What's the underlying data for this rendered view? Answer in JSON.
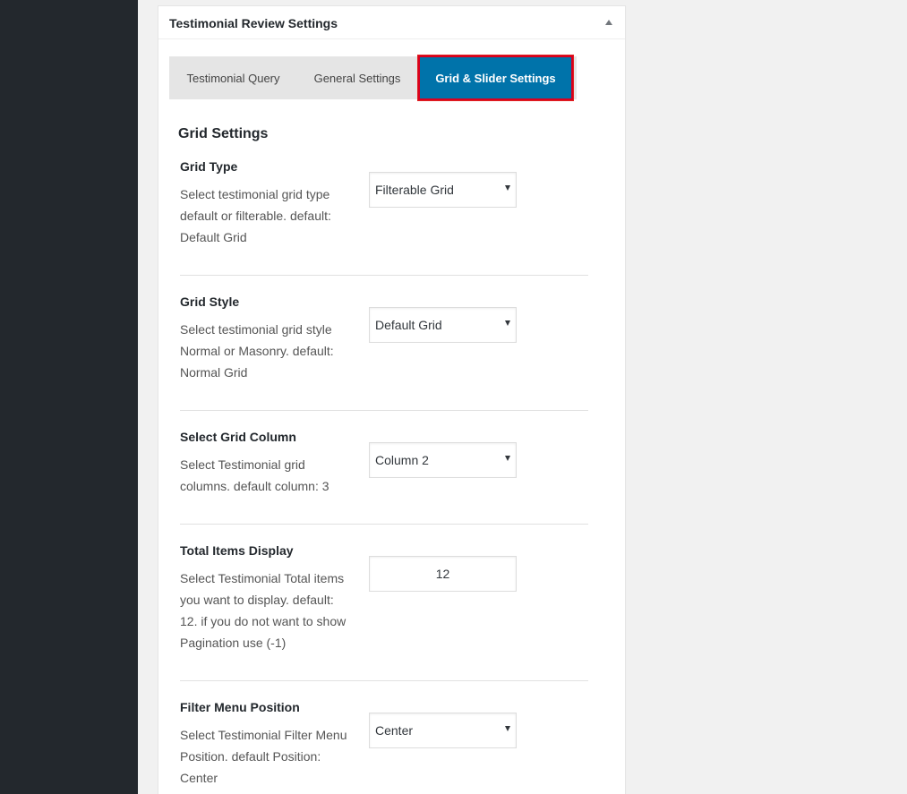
{
  "metabox": {
    "title": "Testimonial Review Settings"
  },
  "tabs": [
    {
      "label": "Testimonial Query"
    },
    {
      "label": "General Settings"
    },
    {
      "label": "Grid & Slider Settings",
      "active": true
    }
  ],
  "section": {
    "title": "Grid Settings"
  },
  "fields": {
    "grid_type": {
      "label": "Grid Type",
      "description": "Select testimonial grid type default or filterable. default: Default Grid",
      "value": "Filterable Grid"
    },
    "grid_style": {
      "label": "Grid Style",
      "description": "Select testimonial grid style Normal or Masonry. default: Normal Grid",
      "value": "Default Grid"
    },
    "grid_column": {
      "label": "Select Grid Column",
      "description": "Select Testimonial grid columns. default column: 3",
      "value": "Column 2"
    },
    "total_items": {
      "label": "Total Items Display",
      "description": "Select Testimonial Total items you want to display. default: 12. if you do not want to show Pagination use (-1)",
      "value": "12"
    },
    "filter_position": {
      "label": "Filter Menu Position",
      "description": "Select Testimonial Filter Menu Position. default Position: Center",
      "value": "Center"
    }
  },
  "colors": {
    "active_tab": "#0073aa",
    "active_tab_outline": "#d9001f",
    "sidebar": "#23282d"
  }
}
